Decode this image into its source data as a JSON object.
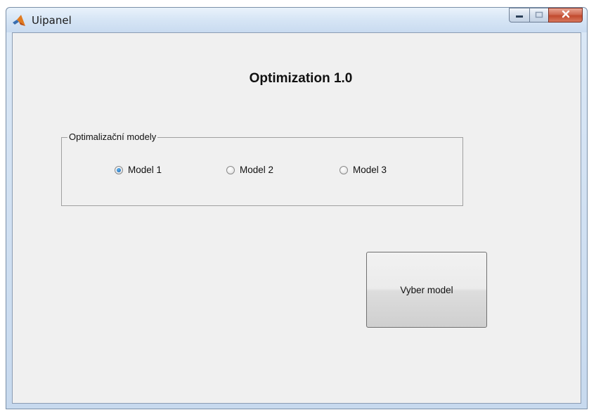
{
  "window": {
    "title": "Uipanel"
  },
  "heading": "Optimization 1.0",
  "panel": {
    "title": "Optimalizační modely",
    "options": [
      {
        "label": "Model 1",
        "selected": true
      },
      {
        "label": "Model 2",
        "selected": false
      },
      {
        "label": "Model 3",
        "selected": false
      }
    ]
  },
  "action": {
    "label": "Vyber model"
  },
  "icons": {
    "app": "matlab-logo-icon",
    "minimize": "minimize-icon",
    "maximize": "maximize-icon",
    "close": "close-icon"
  },
  "colors": {
    "close_button": "#c24a2e",
    "radio_selected": "#1a5fa8"
  }
}
